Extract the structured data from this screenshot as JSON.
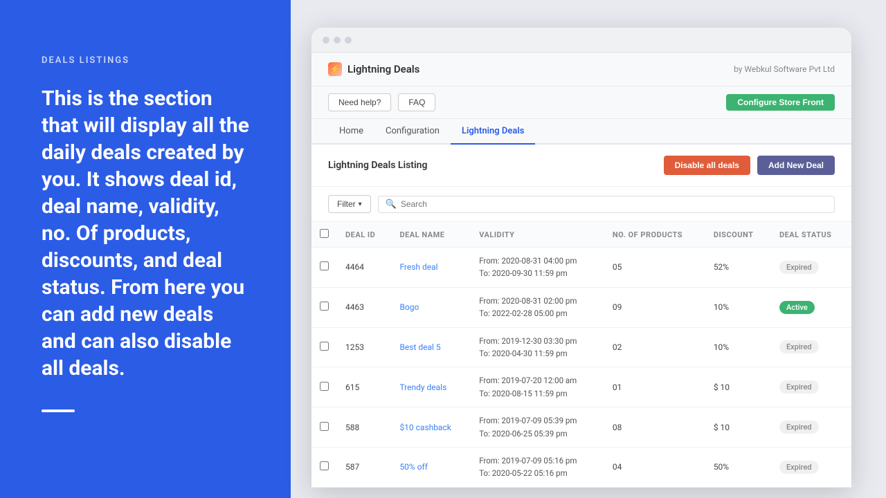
{
  "left": {
    "section_label": "DEALS LISTINGS",
    "description": "This is the section that will display all the daily deals created by you. It shows deal id, deal name, validity, no. Of products, discounts, and deal status. From here you can add new deals and can also disable all deals."
  },
  "app": {
    "title": "Lightning Deals",
    "by_text": "by Webkul Software Pvt Ltd",
    "logo_emoji": "⚡"
  },
  "toolbar": {
    "need_help": "Need help?",
    "faq": "FAQ",
    "configure": "Configure Store Front"
  },
  "nav": {
    "tabs": [
      {
        "label": "Home",
        "active": false
      },
      {
        "label": "Configuration",
        "active": false
      },
      {
        "label": "Lightning Deals",
        "active": true
      }
    ]
  },
  "deals_listing": {
    "title": "Lightning Deals Listing",
    "disable_all": "Disable all deals",
    "add_new": "Add New Deal"
  },
  "filter": {
    "filter_label": "Filter",
    "search_placeholder": "Search"
  },
  "table": {
    "columns": [
      "DEAL ID",
      "DEAL NAME",
      "VALIDITY",
      "NO. OF PRODUCTS",
      "DISCOUNT",
      "DEAL STATUS"
    ],
    "rows": [
      {
        "id": "4464",
        "name": "Fresh deal",
        "validity_from": "From: 2020-08-31 04:00 pm",
        "validity_to": "To: 2020-09-30 11:59 pm",
        "products": "05",
        "discount": "52%",
        "status": "Expired",
        "status_type": "expired"
      },
      {
        "id": "4463",
        "name": "Bogo",
        "validity_from": "From: 2020-08-31 02:00 pm",
        "validity_to": "To: 2022-02-28 05:00 pm",
        "products": "09",
        "discount": "10%",
        "status": "Active",
        "status_type": "active"
      },
      {
        "id": "1253",
        "name": "Best deal 5",
        "validity_from": "From: 2019-12-30 03:30 pm",
        "validity_to": "To: 2020-04-30 11:59 pm",
        "products": "02",
        "discount": "10%",
        "status": "Expired",
        "status_type": "expired"
      },
      {
        "id": "615",
        "name": "Trendy deals",
        "validity_from": "From: 2019-07-20 12:00 am",
        "validity_to": "To: 2020-08-15 11:59 pm",
        "products": "01",
        "discount": "$ 10",
        "status": "Expired",
        "status_type": "expired"
      },
      {
        "id": "588",
        "name": "$10 cashback",
        "validity_from": "From: 2019-07-09 05:39 pm",
        "validity_to": "To: 2020-06-25 05:39 pm",
        "products": "08",
        "discount": "$ 10",
        "status": "Expired",
        "status_type": "expired"
      },
      {
        "id": "587",
        "name": "50% off",
        "validity_from": "From: 2019-07-09 05:16 pm",
        "validity_to": "To: 2020-05-22 05:16 pm",
        "products": "04",
        "discount": "50%",
        "status": "Expired",
        "status_type": "expired"
      }
    ]
  }
}
